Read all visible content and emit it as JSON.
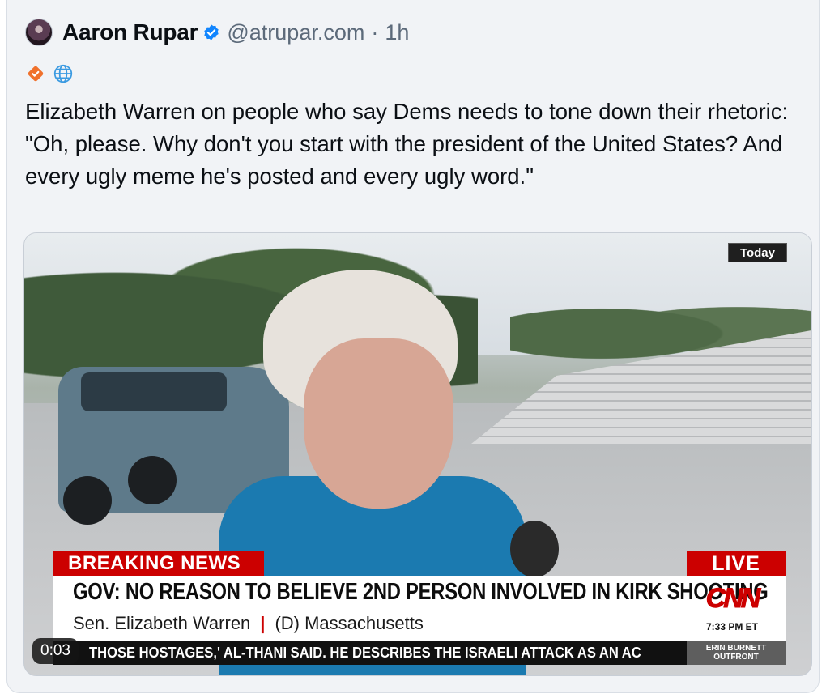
{
  "post": {
    "author_name": "Aaron Rupar",
    "handle": "@atrupar.com",
    "separator": "·",
    "time": "1h",
    "text": "Elizabeth Warren on people who say Dems needs to tone down their rhetoric: \"Oh, please. Why don't you start with the president of the United States? And every ugly meme he's posted and every ugly word.\""
  },
  "icons": {
    "verified": "verified-check-icon",
    "badge": "orange-check-badge-icon",
    "globe": "globe-icon"
  },
  "colors": {
    "verified_blue": "#1185fe",
    "badge_orange": "#f0712c",
    "globe_blue": "#3b9ae1",
    "cnn_red": "#cc0000"
  },
  "video": {
    "today_badge": "Today",
    "breaking_label": "BREAKING NEWS",
    "live_label": "LIVE",
    "headline": "GOV: NO REASON TO BELIEVE 2ND PERSON INVOLVED IN KIRK SHOOTING",
    "subline_name": "Sen. Elizabeth Warren",
    "subline_sep": "|",
    "subline_party": "(D) Massachusetts",
    "network_logo": "CNN",
    "network_time": "7:33 PM ET",
    "ticker": "THOSE HOSTAGES,' AL-THANI SAID. HE DESCRIBES THE ISRAELI ATTACK AS AN AC",
    "show_line1": "ERIN BURNETT",
    "show_line2": "OUTFRONT",
    "timestamp": "0:03"
  }
}
